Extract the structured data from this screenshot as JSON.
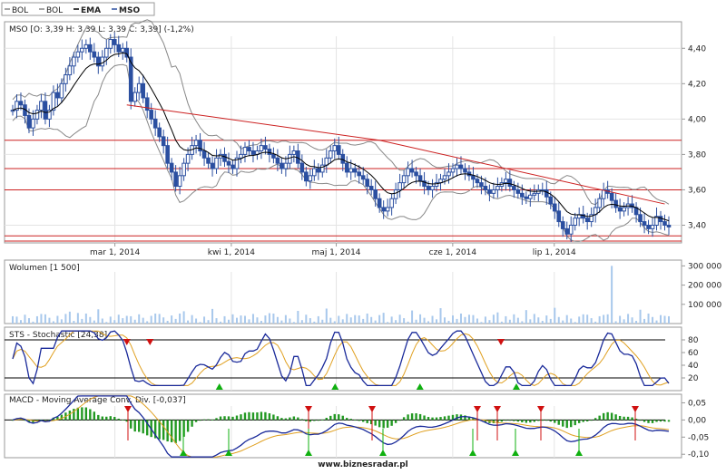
{
  "legend": [
    {
      "label": "BOL",
      "color": "#888888",
      "bold": false
    },
    {
      "label": "BOL",
      "color": "#888888",
      "bold": false
    },
    {
      "label": "EMA",
      "color": "#000000",
      "bold": true
    },
    {
      "label": "MSO",
      "color": "#2b4fa0",
      "bold": true
    }
  ],
  "footer": "www.biznesradar.pl",
  "chart_data": [
    {
      "type": "candlestick",
      "title": "MSO [O: 3,39  H: 3,39  L: 3,39  C: 3,39] (-1,2%)",
      "x_ticks": [
        "mar 1, 2014",
        "kwi 1, 2014",
        "maj 1, 2014",
        "cze 1, 2014",
        "lip 1, 2014"
      ],
      "y_ticks": [
        "4,40",
        "4,20",
        "4,00",
        "3,80",
        "3,60",
        "3,40"
      ],
      "ylim": [
        3.3,
        4.55
      ],
      "close": [
        4.05,
        4.1,
        4.08,
        4.02,
        3.95,
        4.0,
        4.05,
        4.1,
        4.0,
        4.05,
        4.15,
        4.12,
        4.2,
        4.25,
        4.3,
        4.35,
        4.38,
        4.4,
        4.42,
        4.38,
        4.35,
        4.3,
        4.35,
        4.4,
        4.45,
        4.42,
        4.38,
        4.4,
        4.35,
        4.1,
        4.15,
        4.2,
        4.12,
        4.05,
        4.0,
        3.95,
        3.9,
        3.85,
        3.75,
        3.7,
        3.62,
        3.68,
        3.75,
        3.8,
        3.85,
        3.88,
        3.82,
        3.78,
        3.75,
        3.72,
        3.78,
        3.8,
        3.76,
        3.74,
        3.72,
        3.78,
        3.8,
        3.84,
        3.82,
        3.8,
        3.82,
        3.85,
        3.83,
        3.8,
        3.78,
        3.75,
        3.72,
        3.75,
        3.8,
        3.82,
        3.75,
        3.7,
        3.65,
        3.68,
        3.72,
        3.7,
        3.74,
        3.78,
        3.82,
        3.85,
        3.8,
        3.75,
        3.7,
        3.72,
        3.7,
        3.68,
        3.66,
        3.62,
        3.6,
        3.55,
        3.5,
        3.48,
        3.5,
        3.55,
        3.6,
        3.64,
        3.68,
        3.72,
        3.7,
        3.68,
        3.65,
        3.62,
        3.6,
        3.62,
        3.64,
        3.66,
        3.68,
        3.7,
        3.72,
        3.74,
        3.72,
        3.7,
        3.68,
        3.66,
        3.64,
        3.62,
        3.6,
        3.58,
        3.6,
        3.62,
        3.64,
        3.66,
        3.62,
        3.6,
        3.58,
        3.56,
        3.55,
        3.57,
        3.58,
        3.6,
        3.6,
        3.56,
        3.52,
        3.48,
        3.42,
        3.38,
        3.35,
        3.4,
        3.44,
        3.46,
        3.44,
        3.42,
        3.46,
        3.5,
        3.55,
        3.6,
        3.58,
        3.54,
        3.5,
        3.48,
        3.5,
        3.52,
        3.5,
        3.46,
        3.42,
        3.4,
        3.38,
        3.4,
        3.45,
        3.42,
        3.4,
        3.39
      ],
      "horizontal_lines": [
        3.88,
        3.72,
        3.6,
        3.34,
        3.31
      ],
      "trendline": {
        "from": [
          4.08,
          3.88
        ],
        "to": [
          3.73,
          3.52
        ]
      }
    },
    {
      "type": "bar",
      "title": "Wolumen [1 500]",
      "y_ticks": [
        "300 000",
        "200 000",
        "100 000"
      ],
      "ylim": [
        0,
        330000
      ]
    },
    {
      "type": "line",
      "title": "STS - Stochastic [24,38]",
      "y_ticks": [
        "80",
        "60",
        "40",
        "20"
      ],
      "ylim": [
        0,
        100
      ],
      "levels": [
        80,
        20
      ]
    },
    {
      "type": "line",
      "title": "MACD - Moving Average Conv. Div. [-0,037]",
      "y_ticks": [
        "0,05",
        "0,00",
        "-0,05",
        "-0,10"
      ],
      "ylim": [
        -0.11,
        0.075
      ]
    }
  ]
}
